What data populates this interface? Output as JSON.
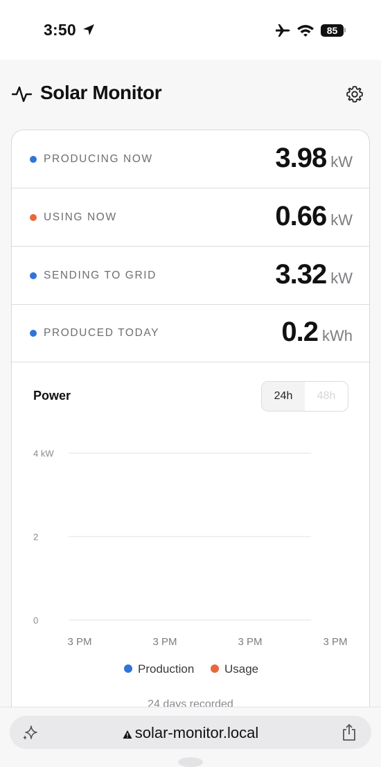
{
  "status_bar": {
    "time": "3:50",
    "battery": "85"
  },
  "header": {
    "title": "Solar Monitor"
  },
  "stats": [
    {
      "label": "PRODUCING NOW",
      "value": "3.98",
      "unit": "kW",
      "dot_color": "#2f74d8"
    },
    {
      "label": "USING NOW",
      "value": "0.66",
      "unit": "kW",
      "dot_color": "#e8683a"
    },
    {
      "label": "SENDING TO GRID",
      "value": "3.32",
      "unit": "kW",
      "dot_color": "#2f74d8"
    },
    {
      "label": "PRODUCED TODAY",
      "value": "0.2",
      "unit": "kWh",
      "dot_color": "#2f74d8"
    }
  ],
  "chart_section": {
    "title": "Power",
    "range_options": [
      "24h",
      "48h"
    ],
    "selected_range": "24h",
    "days_recorded": "24 days recorded"
  },
  "chart_data": {
    "type": "line",
    "title": "Power",
    "y_tick_labels": [
      "4 kW",
      "2",
      "0"
    ],
    "y_ticks": [
      4,
      2,
      0
    ],
    "ylim": [
      0,
      4
    ],
    "x_tick_labels": [
      "3 PM",
      "3 PM",
      "3 PM",
      "3 PM"
    ],
    "grid": true,
    "legend_position": "bottom",
    "series": [
      {
        "name": "Production",
        "color": "#2f74d8",
        "values": []
      },
      {
        "name": "Usage",
        "color": "#e8683a",
        "values": []
      }
    ]
  },
  "bottom_bar": {
    "url": "solar-monitor.local"
  }
}
